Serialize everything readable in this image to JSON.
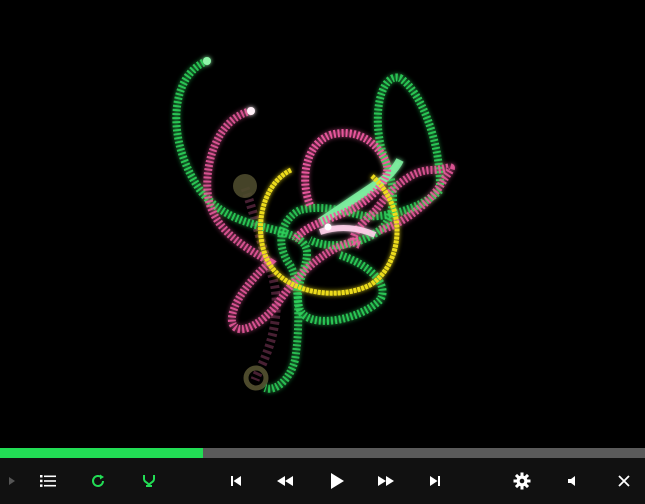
{
  "player": {
    "progress_fraction": 0.315,
    "colors": {
      "accent": "#22dd55",
      "track": "#5a5a5a",
      "bar_bg": "#111111",
      "icon": "#ffffff",
      "icon_muted": "#555555",
      "curve_green": "#2ed15a",
      "curve_pink": "#ee5aa0",
      "ring_yellow": "#f2e21a"
    }
  },
  "controls": {
    "left": [
      {
        "name": "collapse-arrow-icon",
        "icon": "triangle-right"
      },
      {
        "name": "playlist-button",
        "icon": "list-icon"
      },
      {
        "name": "reload-button",
        "icon": "refresh-icon"
      },
      {
        "name": "shuffle-button",
        "icon": "branch-icon"
      }
    ],
    "center": [
      {
        "name": "previous-track-button",
        "icon": "skip-back-icon"
      },
      {
        "name": "rewind-button",
        "icon": "rewind-icon"
      },
      {
        "name": "play-button",
        "icon": "play-icon"
      },
      {
        "name": "fast-forward-button",
        "icon": "fast-forward-icon"
      },
      {
        "name": "next-track-button",
        "icon": "skip-forward-icon"
      }
    ],
    "right": [
      {
        "name": "settings-button",
        "icon": "gear-icon"
      },
      {
        "name": "volume-button",
        "icon": "speaker-icon"
      },
      {
        "name": "close-button",
        "icon": "close-icon"
      }
    ]
  }
}
